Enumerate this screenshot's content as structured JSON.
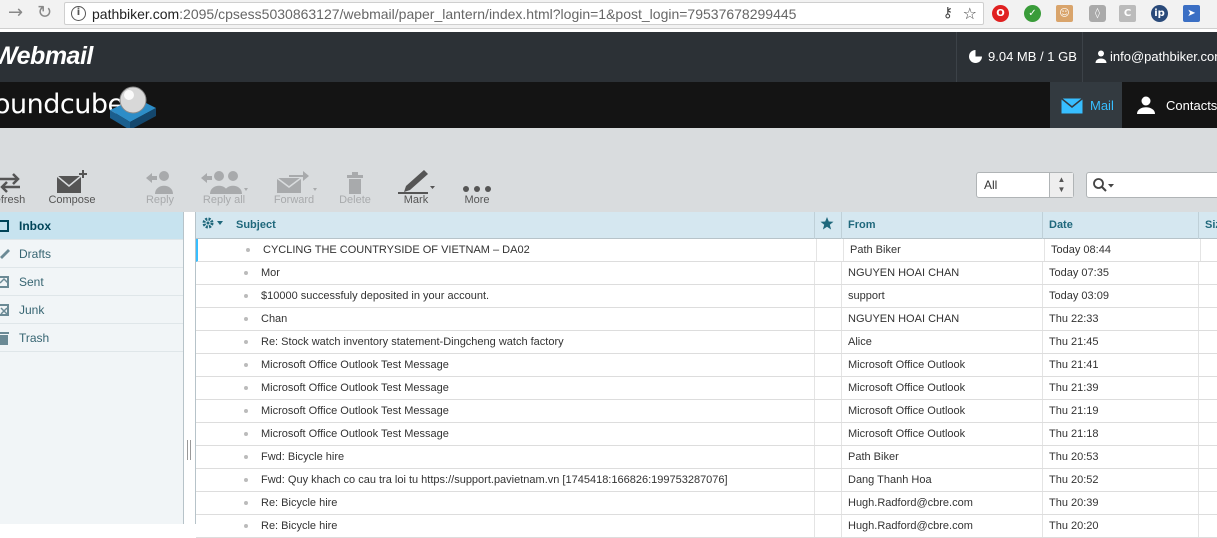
{
  "browser": {
    "url_host": "pathbiker.com",
    "url_rest": ":2095/cpsess5030863127/webmail/paper_lantern/index.html?login=1&post_login=79537678299445"
  },
  "header": {
    "app_title": "Webmail",
    "quota": "9.04 MB / 1 GB",
    "user": "info@pathbiker.com",
    "brand": "oundcube"
  },
  "taskbar": {
    "mail_label": "Mail",
    "contacts_label": "Contacts"
  },
  "toolbar": {
    "refresh": "efresh",
    "compose": "Compose",
    "reply": "Reply",
    "reply_all": "Reply all",
    "forward": "Forward",
    "delete": "Delete",
    "mark": "Mark",
    "more": "More"
  },
  "filter": {
    "selected": "All"
  },
  "folders": [
    {
      "label": "Inbox",
      "icon": "inbox-icon"
    },
    {
      "label": "Drafts",
      "icon": "pencil-icon"
    },
    {
      "label": "Sent",
      "icon": "sent-icon"
    },
    {
      "label": "Junk",
      "icon": "junk-icon"
    },
    {
      "label": "Trash",
      "icon": "trash-icon"
    }
  ],
  "list_header": {
    "subject": "Subject",
    "from": "From",
    "date": "Date",
    "size": "Siz"
  },
  "messages": [
    {
      "subject": "CYCLING THE COUNTRYSIDE OF VIETNAM – DA02",
      "from": "Path Biker",
      "date": "Today 08:44"
    },
    {
      "subject": "Mor",
      "from": "NGUYEN HOAI CHAN",
      "date": "Today 07:35"
    },
    {
      "subject": "$10000 successfuly deposited in your account.",
      "from": "support",
      "date": "Today 03:09"
    },
    {
      "subject": "Chan",
      "from": "NGUYEN HOAI CHAN",
      "date": "Thu 22:33"
    },
    {
      "subject": "Re: Stock watch inventory statement-Dingcheng watch factory",
      "from": "Alice",
      "date": "Thu 21:45"
    },
    {
      "subject": "Microsoft Office Outlook Test Message",
      "from": "Microsoft Office Outlook",
      "date": "Thu 21:41"
    },
    {
      "subject": "Microsoft Office Outlook Test Message",
      "from": "Microsoft Office Outlook",
      "date": "Thu 21:39"
    },
    {
      "subject": "Microsoft Office Outlook Test Message",
      "from": "Microsoft Office Outlook",
      "date": "Thu 21:19"
    },
    {
      "subject": "Microsoft Office Outlook Test Message",
      "from": "Microsoft Office Outlook",
      "date": "Thu 21:18"
    },
    {
      "subject": "Fwd: Bicycle hire",
      "from": "Path Biker",
      "date": "Thu 20:53"
    },
    {
      "subject": "Fwd: Quy khach co cau tra loi tu https://support.pavietnam.vn [1745418:166826:199753287076]",
      "from": "Dang Thanh Hoa",
      "date": "Thu 20:52"
    },
    {
      "subject": "Re: Bicycle hire",
      "from": "Hugh.Radford@cbre.com",
      "date": "Thu 20:39"
    },
    {
      "subject": "Re: Bicycle hire",
      "from": "Hugh.Radford@cbre.com",
      "date": "Thu 20:20"
    }
  ]
}
